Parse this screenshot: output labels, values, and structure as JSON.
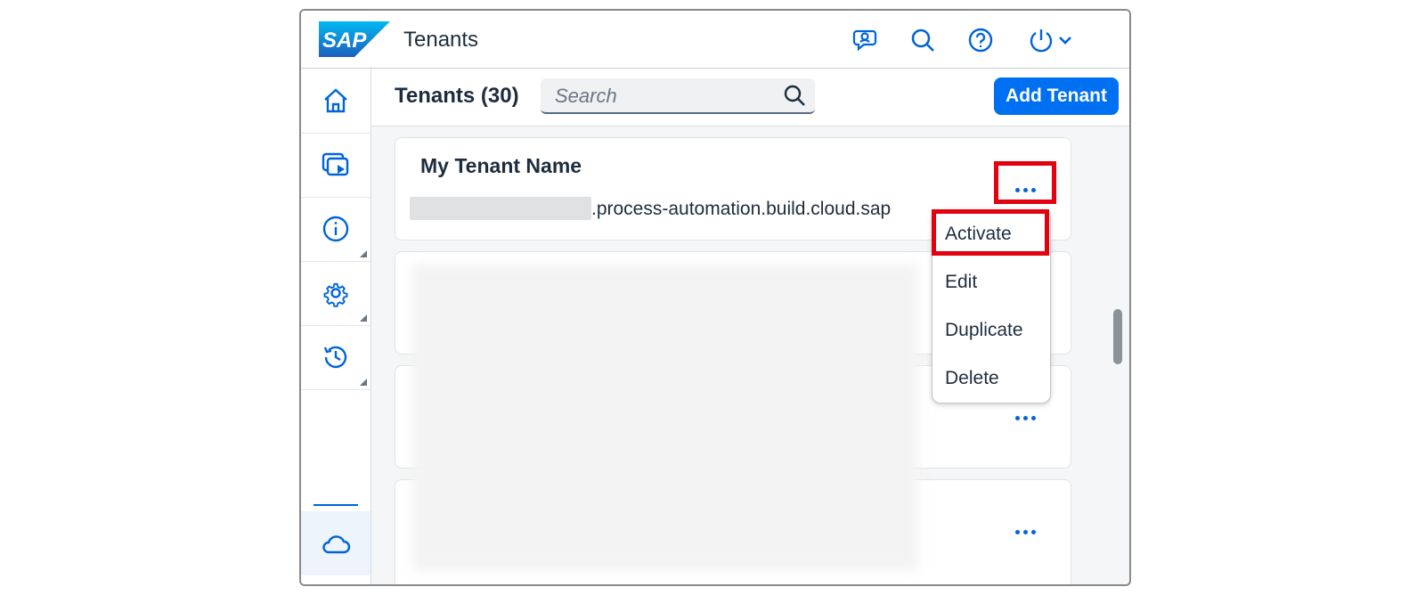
{
  "shell": {
    "logo_text": "SAP",
    "title": "Tenants"
  },
  "icons": {
    "shell": [
      "feedback-icon",
      "search-icon",
      "help-icon",
      "power-icon",
      "chevron-down-icon"
    ],
    "nav": [
      "home-icon",
      "run-icon",
      "info-icon",
      "gear-icon",
      "history-icon",
      "cloud-icon"
    ]
  },
  "toolbar": {
    "list_title": "Tenants (30)",
    "search_placeholder": "Search",
    "add_button_label": "Add Tenant"
  },
  "tenant_card": {
    "name": "My Tenant Name",
    "url_suffix": ".process-automation.build.cloud.sap"
  },
  "context_menu": {
    "items": [
      "Activate",
      "Edit",
      "Duplicate",
      "Delete"
    ]
  },
  "colors": {
    "accent": "#0070f2",
    "highlight": "#e3000f",
    "text": "#1d2d3e"
  }
}
